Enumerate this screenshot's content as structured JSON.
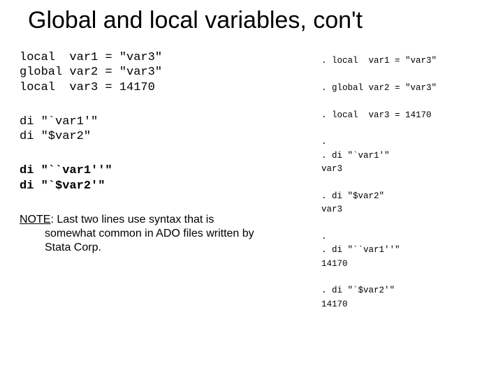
{
  "title": "Global and local variables, con't",
  "code": {
    "block1": "local  var1 = \"var3\"\nglobal var2 = \"var3\"\nlocal  var3 = 14170",
    "block2": "di \"`var1'\"\ndi \"$var2\"",
    "block3": "di \"``var1''\"\ndi \"`$var2'\""
  },
  "note": {
    "label": "NOTE",
    "text_line1": ": Last two lines use syntax that is",
    "text_rest": "somewhat common in ADO files written by Stata Corp."
  },
  "output": ". local  var1 = \"var3\"\n\n. global var2 = \"var3\"\n\n. local  var3 = 14170\n\n.\n. di \"`var1'\"\nvar3\n\n. di \"$var2\"\nvar3\n\n.\n. di \"``var1''\"\n14170\n\n. di \"`$var2'\"\n14170"
}
